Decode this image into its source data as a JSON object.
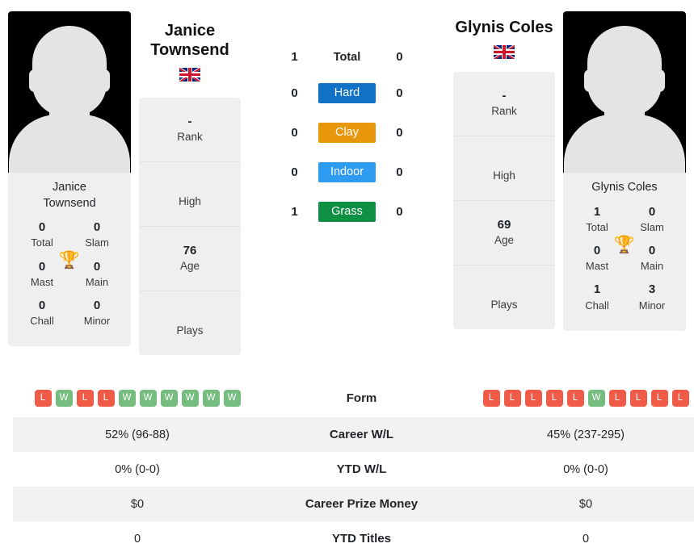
{
  "players": {
    "left": {
      "full_name_line1": "Janice",
      "full_name_line2": "Townsend",
      "card_name_line1": "Janice",
      "card_name_line2": "Townsend",
      "flag": "gb-flag-icon",
      "avatar": "player-silhouette-placeholder",
      "titles": {
        "total_value": "0",
        "total_label": "Total",
        "slam_value": "0",
        "slam_label": "Slam",
        "mast_value": "0",
        "mast_label": "Mast",
        "main_value": "0",
        "main_label": "Main",
        "chall_value": "0",
        "chall_label": "Chall",
        "minor_value": "0",
        "minor_label": "Minor",
        "trophy_icon": "trophy-icon"
      },
      "info": [
        {
          "value": "-",
          "label": "Rank"
        },
        {
          "value": "",
          "label": "High"
        },
        {
          "value": "76",
          "label": "Age"
        },
        {
          "value": "",
          "label": "Plays"
        }
      ],
      "form": [
        "L",
        "W",
        "L",
        "L",
        "W",
        "W",
        "W",
        "W",
        "W",
        "W"
      ],
      "career_wl": "52% (96-88)",
      "ytd_wl": "0% (0-0)",
      "career_prize_money": "$0",
      "ytd_titles": "0"
    },
    "right": {
      "full_name_line1": "Glynis Coles",
      "full_name_line2": "",
      "card_name_line1": "Glynis Coles",
      "card_name_line2": "",
      "flag": "gb-flag-icon",
      "avatar": "player-silhouette-placeholder",
      "titles": {
        "total_value": "1",
        "total_label": "Total",
        "slam_value": "0",
        "slam_label": "Slam",
        "mast_value": "0",
        "mast_label": "Mast",
        "main_value": "0",
        "main_label": "Main",
        "chall_value": "1",
        "chall_label": "Chall",
        "minor_value": "3",
        "minor_label": "Minor",
        "trophy_icon": "trophy-icon"
      },
      "info": [
        {
          "value": "-",
          "label": "Rank"
        },
        {
          "value": "",
          "label": "High"
        },
        {
          "value": "69",
          "label": "Age"
        },
        {
          "value": "",
          "label": "Plays"
        }
      ],
      "form": [
        "L",
        "L",
        "L",
        "L",
        "L",
        "W",
        "L",
        "L",
        "L",
        "L"
      ],
      "career_wl": "45% (237-295)",
      "ytd_wl": "0% (0-0)",
      "career_prize_money": "$0",
      "ytd_titles": "0"
    }
  },
  "surface_comparison": [
    {
      "label": "Total",
      "left": "1",
      "right": "0",
      "color": "",
      "plain": true
    },
    {
      "label": "Hard",
      "left": "0",
      "right": "0",
      "color": "#0f72c4",
      "plain": false
    },
    {
      "label": "Clay",
      "left": "0",
      "right": "0",
      "color": "#e8960c",
      "plain": false
    },
    {
      "label": "Indoor",
      "left": "0",
      "right": "0",
      "color": "#2d9bf0",
      "plain": false
    },
    {
      "label": "Grass",
      "left": "1",
      "right": "0",
      "color": "#109044",
      "plain": false
    }
  ],
  "stats_rows": [
    {
      "label": "Form",
      "left": "",
      "right": "",
      "is_form": true
    },
    {
      "label": "Career W/L",
      "left": "52% (96-88)",
      "right": "45% (237-295)",
      "is_form": false
    },
    {
      "label": "YTD W/L",
      "left": "0% (0-0)",
      "right": "0% (0-0)",
      "is_form": false
    },
    {
      "label": "Career Prize Money",
      "left": "$0",
      "right": "$0",
      "is_form": false
    },
    {
      "label": "YTD Titles",
      "left": "0",
      "right": "0",
      "is_form": false
    }
  ],
  "colors": {
    "win_badge": "#74bd7f",
    "loss_badge": "#ef5b47",
    "panel_bg": "#efefef",
    "row_alt_bg": "#f2f2f2",
    "trophy": "#3d6cb0"
  }
}
